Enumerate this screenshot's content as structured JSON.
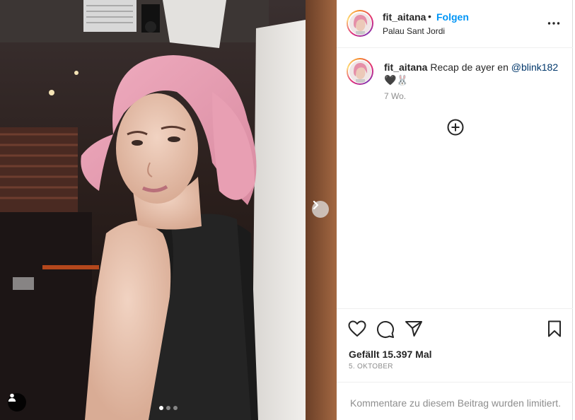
{
  "post": {
    "username": "fit_aitana",
    "separator": "•",
    "follow_label": "Folgen",
    "location": "Palau Sant Jordi",
    "more_icon": "more-horizontal-icon",
    "caption_user": "fit_aitana",
    "caption_text": " Recap de ayer en ",
    "caption_mention": "@blink182",
    "caption_emoji": "🖤🐰",
    "caption_time": "7 Wo.",
    "likes": "Gefällt 15.397 Mal",
    "date": "5. OKTOBER",
    "comments_limited": "Kommentare zu diesem Beitrag wurden limitiert."
  },
  "media": {
    "carousel_total": 3,
    "carousel_active": 1
  },
  "colors": {
    "accent": "#0095f6",
    "mention": "#00376b",
    "muted": "#8e8e8e",
    "hair": "#e59aac"
  }
}
